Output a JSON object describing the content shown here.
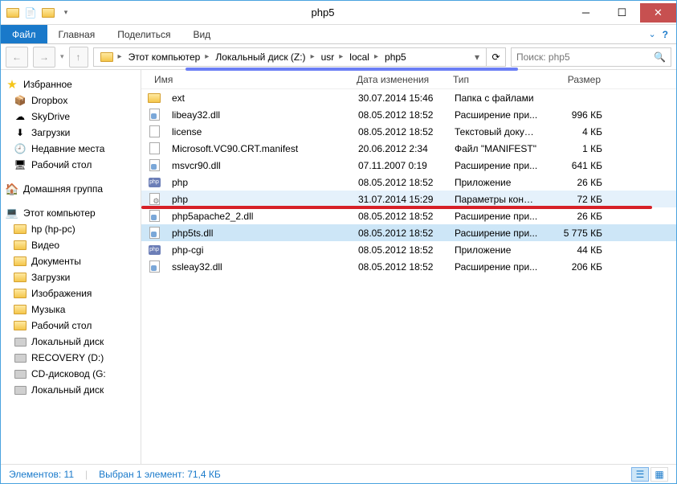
{
  "title": "php5",
  "ribbon": {
    "file": "Файл",
    "tabs": [
      "Главная",
      "Поделиться",
      "Вид"
    ]
  },
  "breadcrumb": [
    "Этот компьютер",
    "Локальный диск (Z:)",
    "usr",
    "local",
    "php5"
  ],
  "search": {
    "placeholder": "Поиск: php5"
  },
  "sidebar": {
    "favorites": {
      "label": "Избранное",
      "items": [
        "Dropbox",
        "SkyDrive",
        "Загрузки",
        "Недавние места",
        "Рабочий стол"
      ]
    },
    "homegroup": "Домашняя группа",
    "computer": {
      "label": "Этот компьютер",
      "items": [
        "hp (hp-pc)",
        "Видео",
        "Документы",
        "Загрузки",
        "Изображения",
        "Музыка",
        "Рабочий стол",
        "Локальный диск",
        "RECOVERY (D:)",
        "CD-дисковод (G:",
        "Локальный диск"
      ]
    }
  },
  "columns": {
    "name": "Имя",
    "date": "Дата изменения",
    "type": "Тип",
    "size": "Размер"
  },
  "files": [
    {
      "name": "ext",
      "date": "30.07.2014 15:46",
      "type": "Папка с файлами",
      "size": "",
      "icon": "folder"
    },
    {
      "name": "libeay32.dll",
      "date": "08.05.2012 18:52",
      "type": "Расширение при...",
      "size": "996 КБ",
      "icon": "dll"
    },
    {
      "name": "license",
      "date": "08.05.2012 18:52",
      "type": "Текстовый докум...",
      "size": "4 КБ",
      "icon": "txt"
    },
    {
      "name": "Microsoft.VC90.CRT.manifest",
      "date": "20.06.2012 2:34",
      "type": "Файл \"MANIFEST\"",
      "size": "1 КБ",
      "icon": "txt"
    },
    {
      "name": "msvcr90.dll",
      "date": "07.11.2007 0:19",
      "type": "Расширение при...",
      "size": "641 КБ",
      "icon": "dll"
    },
    {
      "name": "php",
      "date": "08.05.2012 18:52",
      "type": "Приложение",
      "size": "26 КБ",
      "icon": "php"
    },
    {
      "name": "php",
      "date": "31.07.2014 15:29",
      "type": "Параметры конф...",
      "size": "72 КБ",
      "icon": "cfg",
      "highlight": true
    },
    {
      "name": "php5apache2_2.dll",
      "date": "08.05.2012 18:52",
      "type": "Расширение при...",
      "size": "26 КБ",
      "icon": "dll"
    },
    {
      "name": "php5ts.dll",
      "date": "08.05.2012 18:52",
      "type": "Расширение при...",
      "size": "5 775 КБ",
      "icon": "dll",
      "selected": true
    },
    {
      "name": "php-cgi",
      "date": "08.05.2012 18:52",
      "type": "Приложение",
      "size": "44 КБ",
      "icon": "php"
    },
    {
      "name": "ssleay32.dll",
      "date": "08.05.2012 18:52",
      "type": "Расширение при...",
      "size": "206 КБ",
      "icon": "dll"
    }
  ],
  "status": {
    "count": "Элементов: 11",
    "selection": "Выбран 1 элемент: 71,4 КБ"
  }
}
